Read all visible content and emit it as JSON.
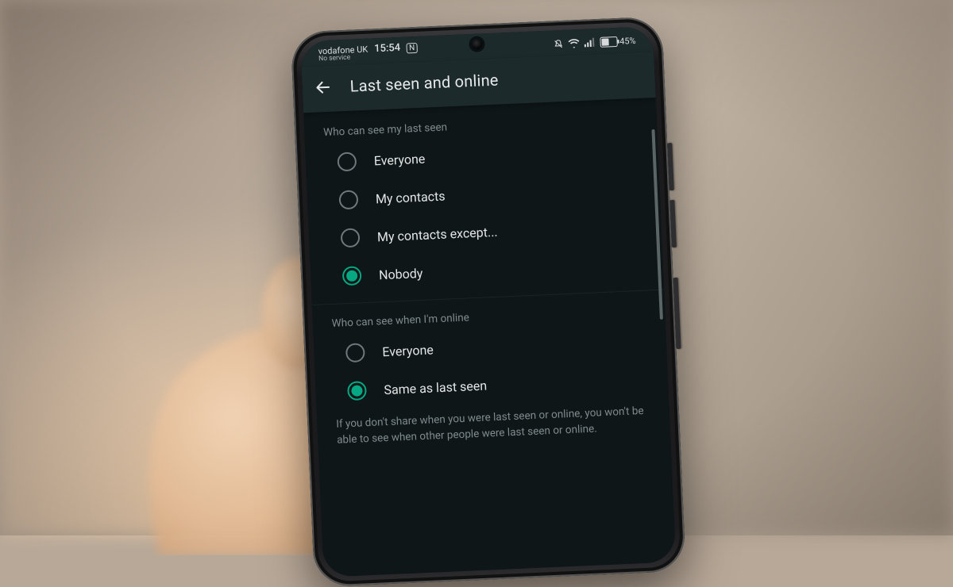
{
  "status": {
    "carrier": "vodafone UK",
    "service": "No service",
    "time": "15:54",
    "nfc_label": "N",
    "battery_pct": 45,
    "battery_label": "45%"
  },
  "appbar": {
    "title": "Last seen and online"
  },
  "sections": {
    "last_seen": {
      "title": "Who can see my last seen",
      "options": {
        "everyone": "Everyone",
        "my_contacts": "My contacts",
        "my_contacts_except": "My contacts except...",
        "nobody": "Nobody"
      },
      "selected": "nobody"
    },
    "online": {
      "title": "Who can see when I'm online",
      "options": {
        "everyone": "Everyone",
        "same_as_last_seen": "Same as last seen"
      },
      "selected": "same_as_last_seen"
    }
  },
  "footnote": "If you don't share when you were last seen or online, you won't be able to see when other people were last seen or online.",
  "colors": {
    "accent": "#06a884",
    "bg_dark": "#0e1617",
    "appbar_bg": "#1d2a2c",
    "text_secondary": "#7f8a8c"
  }
}
